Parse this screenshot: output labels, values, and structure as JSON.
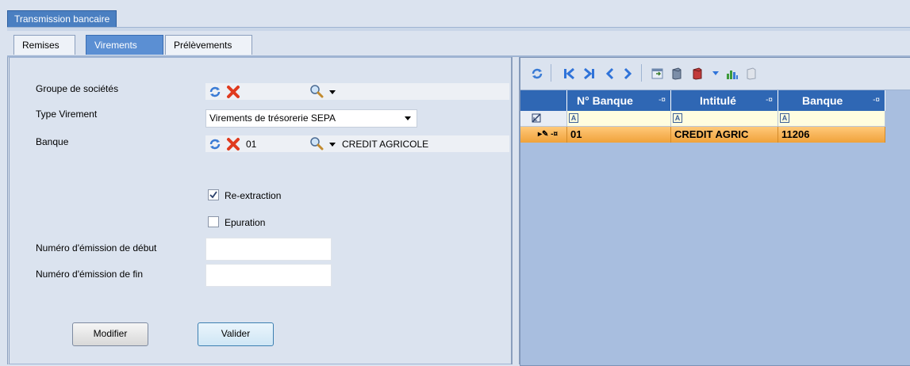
{
  "window": {
    "title": "Transmission bancaire"
  },
  "tabs": [
    {
      "label": "Remises"
    },
    {
      "label": "Virements"
    },
    {
      "label": "Prélèvements"
    }
  ],
  "form": {
    "groupe_label": "Groupe de sociétés",
    "type_label": "Type Virement",
    "type_value": "Virements de trésorerie SEPA",
    "banque_label": "Banque",
    "banque_code": "01",
    "banque_name": "CREDIT AGRICOLE",
    "reextraction_label": "Re-extraction",
    "reextraction_checked": true,
    "epuration_label": "Epuration",
    "epuration_checked": false,
    "num_debut_label": "Numéro d'émission de début",
    "num_fin_label": "Numéro d'émission de fin",
    "modifier_label": "Modifier",
    "valider_label": "Valider"
  },
  "grid": {
    "columns": [
      "N° Banque",
      "Intitulé",
      "Banque"
    ],
    "rows": [
      {
        "num": "01",
        "intitule": "CREDIT AGRIC",
        "banque": "11206"
      }
    ]
  }
}
